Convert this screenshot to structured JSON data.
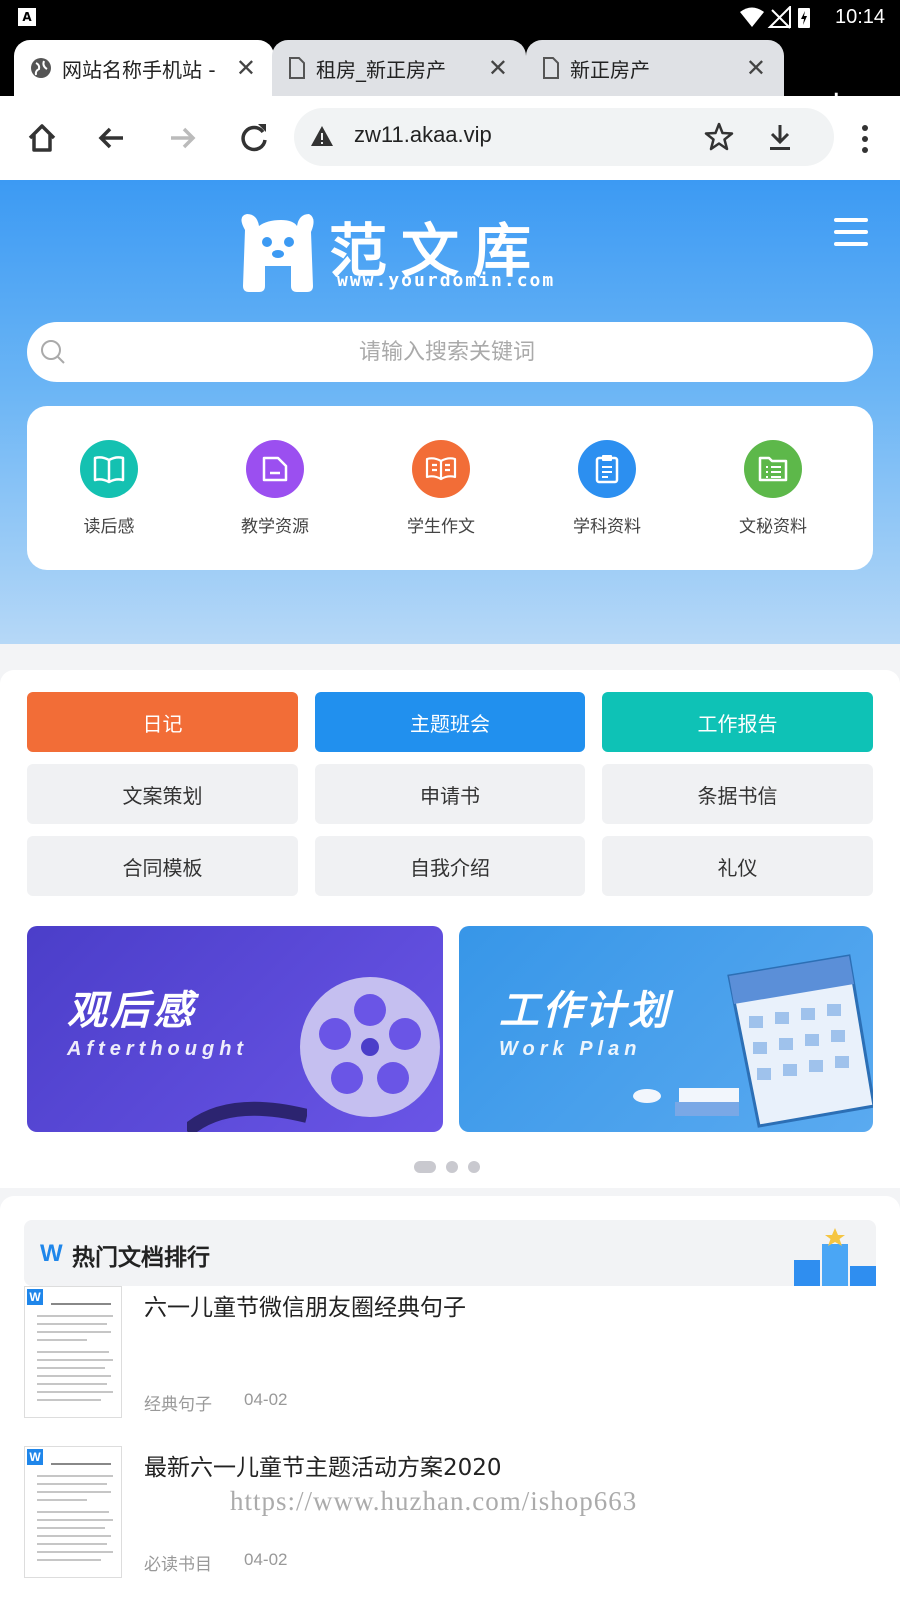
{
  "status": {
    "app_icon": "A",
    "time": "10:14",
    "icons": [
      "wifi-icon",
      "no-signal-icon",
      "battery-charging-icon"
    ]
  },
  "browser": {
    "tabs": [
      {
        "label": "网站名称手机站 -",
        "icon": "globe-icon",
        "active": true
      },
      {
        "label": "租房_新正房产",
        "icon": "page-icon",
        "active": false
      },
      {
        "label": "新正房产",
        "icon": "page-icon",
        "active": false
      }
    ],
    "url": "zw11.akaa.vip"
  },
  "site": {
    "logo_title": "范文库",
    "logo_sub": "www.yourdomin.com",
    "search_placeholder": "请输入搜索关键词",
    "categories": [
      {
        "label": "读后感",
        "icon": "book-icon",
        "color": "#14c1b1"
      },
      {
        "label": "教学资源",
        "icon": "folder-icon",
        "color": "#9b4ff0"
      },
      {
        "label": "学生作文",
        "icon": "open-book-icon",
        "color": "#f26d37"
      },
      {
        "label": "学科资料",
        "icon": "clipboard-icon",
        "color": "#2c8ff0"
      },
      {
        "label": "文秘资料",
        "icon": "list-document-icon",
        "color": "#5db84a"
      }
    ],
    "chips": [
      {
        "label": "日记",
        "color": "#f26d37"
      },
      {
        "label": "主题班会",
        "color": "#2190ee"
      },
      {
        "label": "工作报告",
        "color": "#0ec2b6"
      },
      {
        "label": "文案策划"
      },
      {
        "label": "申请书"
      },
      {
        "label": "条据书信"
      },
      {
        "label": "合同模板"
      },
      {
        "label": "自我介绍"
      },
      {
        "label": "礼仪"
      }
    ],
    "banners": [
      {
        "title": "观后感",
        "subtitle": "Afterthought",
        "color": "#5a45d8"
      },
      {
        "title": "工作计划",
        "subtitle": "Work Plan",
        "color": "#3796e8"
      }
    ],
    "hot": {
      "title": "热门文档排行",
      "items": [
        {
          "title": "六一儿童节微信朋友圈经典句子",
          "category": "经典句子",
          "date": "04-02"
        },
        {
          "title": "最新六一儿童节主题活动方案2020",
          "category": "必读书目",
          "date": "04-02"
        }
      ]
    },
    "watermark": "https://www.huzhan.com/ishop663"
  }
}
